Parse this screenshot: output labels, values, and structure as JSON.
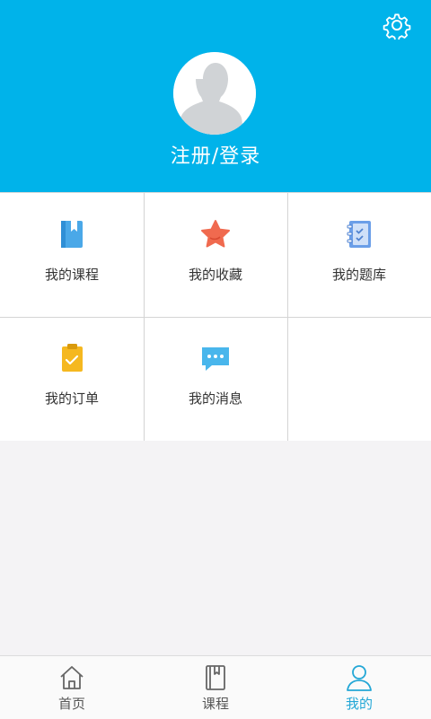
{
  "header": {
    "login_label": "注册/登录",
    "background": "#00b3ea",
    "settings_icon": "gear-icon"
  },
  "menu": [
    {
      "label": "我的课程",
      "icon": "book-icon",
      "color": "#4aa8e8"
    },
    {
      "label": "我的收藏",
      "icon": "star-icon",
      "color": "#f06a4f"
    },
    {
      "label": "我的题库",
      "icon": "notebook-check-icon",
      "color": "#6a9ee8"
    },
    {
      "label": "我的订单",
      "icon": "clipboard-check-icon",
      "color": "#f5b820"
    },
    {
      "label": "我的消息",
      "icon": "chat-bubble-icon",
      "color": "#49b6ec"
    }
  ],
  "tabbar": {
    "tabs": [
      {
        "label": "首页",
        "icon": "home-icon"
      },
      {
        "label": "课程",
        "icon": "book-icon"
      },
      {
        "label": "我的",
        "icon": "user-icon"
      }
    ],
    "active_index": 2,
    "active_color": "#23a7d6"
  }
}
